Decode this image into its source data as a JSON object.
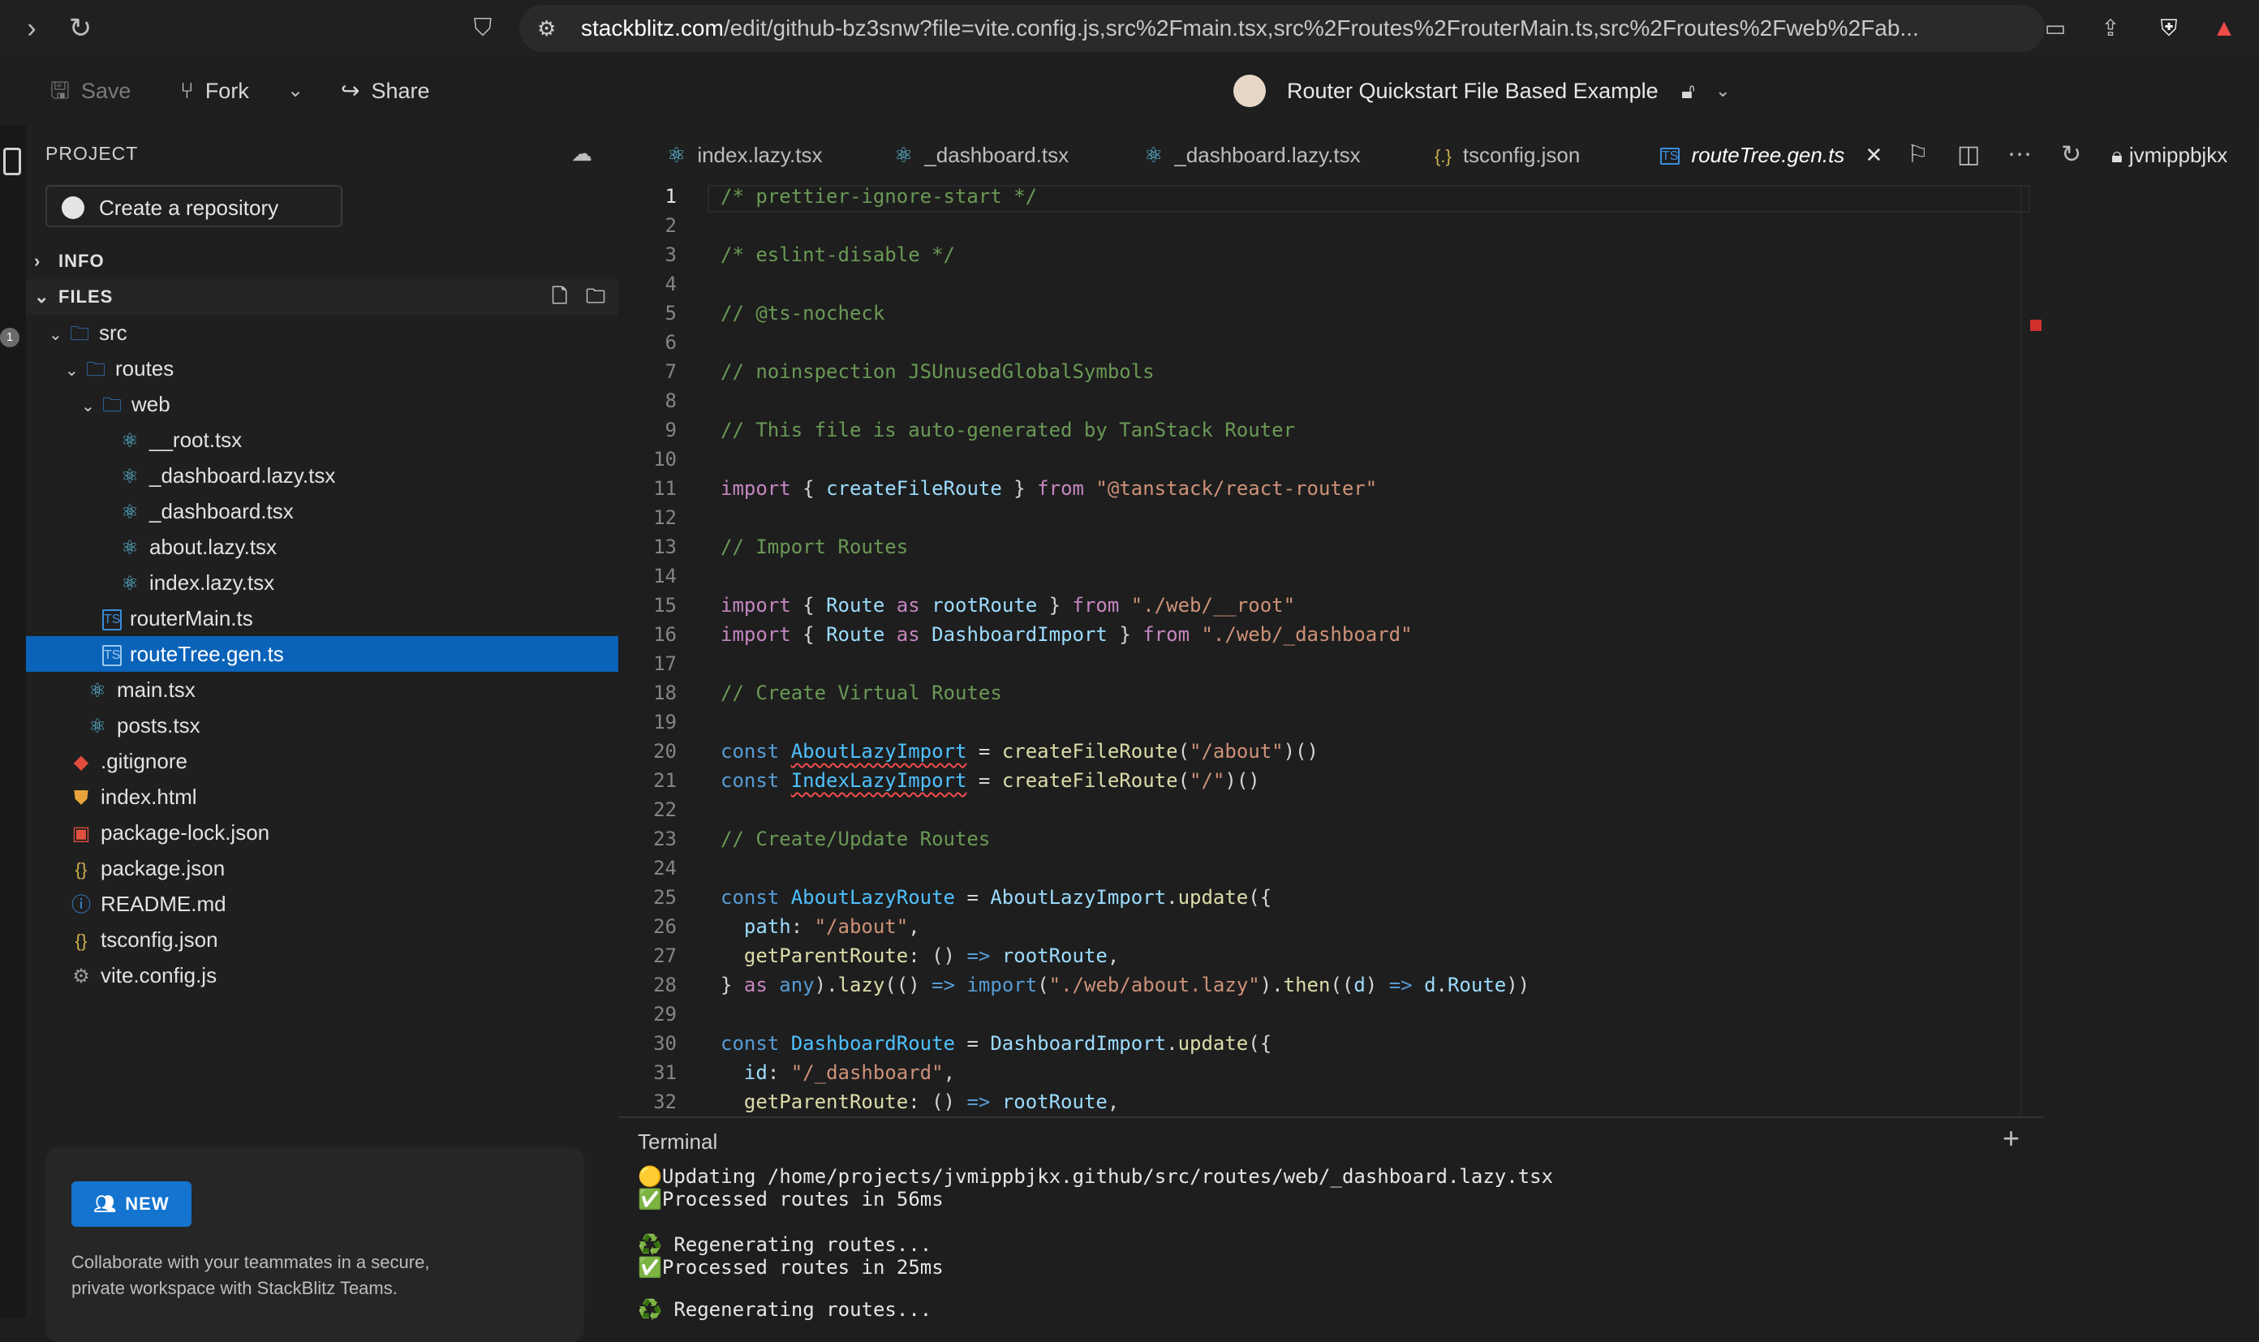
{
  "browser": {
    "url_host": "stackblitz.com",
    "url_path": "/edit/github-bz3snw?file=vite.config.js,src%2Fmain.tsx,src%2Froutes%2FrouterMain.ts,src%2Froutes%2Fweb%2Fab..."
  },
  "header": {
    "save_label": "Save",
    "fork_label": "Fork",
    "share_label": "Share",
    "project_title": "Router Quickstart File Based Example"
  },
  "sidebar": {
    "project_label": "PROJECT",
    "create_repo_label": "Create a repository",
    "info_label": "INFO",
    "files_label": "FILES",
    "tree": [
      {
        "label": "src",
        "icon": "folder"
      },
      {
        "label": "routes",
        "icon": "folder"
      },
      {
        "label": "web",
        "icon": "folder"
      },
      {
        "label": "__root.tsx",
        "icon": "react"
      },
      {
        "label": "_dashboard.lazy.tsx",
        "icon": "react"
      },
      {
        "label": "_dashboard.tsx",
        "icon": "react"
      },
      {
        "label": "about.lazy.tsx",
        "icon": "react"
      },
      {
        "label": "index.lazy.tsx",
        "icon": "react"
      },
      {
        "label": "routerMain.ts",
        "icon": "ts"
      },
      {
        "label": "routeTree.gen.ts",
        "icon": "ts"
      },
      {
        "label": "main.tsx",
        "icon": "react"
      },
      {
        "label": "posts.tsx",
        "icon": "react"
      },
      {
        "label": ".gitignore",
        "icon": "git"
      },
      {
        "label": "index.html",
        "icon": "html5"
      },
      {
        "label": "package-lock.json",
        "icon": "pkglock"
      },
      {
        "label": "package.json",
        "icon": "json"
      },
      {
        "label": "README.md",
        "icon": "info"
      },
      {
        "label": "tsconfig.json",
        "icon": "json"
      },
      {
        "label": "vite.config.js",
        "icon": "gear"
      }
    ],
    "promo": {
      "badge": "NEW",
      "text": "Collaborate with your teammates in a secure, private workspace with StackBlitz Teams."
    }
  },
  "tabs": [
    {
      "label": "index.lazy.tsx",
      "icon": "react"
    },
    {
      "label": "_dashboard.tsx",
      "icon": "react"
    },
    {
      "label": "_dashboard.lazy.tsx",
      "icon": "react"
    },
    {
      "label": "tsconfig.json",
      "icon": "json"
    },
    {
      "label": "routeTree.gen.ts",
      "icon": "ts",
      "active": true
    }
  ],
  "workspace_user": "jvmippbjkx",
  "editor": {
    "line_numbers": [
      "1",
      "2",
      "3",
      "4",
      "5",
      "6",
      "7",
      "8",
      "9",
      "10",
      "11",
      "12",
      "13",
      "14",
      "15",
      "16",
      "17",
      "18",
      "19",
      "20",
      "21",
      "22",
      "23",
      "24",
      "25",
      "26",
      "27",
      "28",
      "29",
      "30",
      "31",
      "32"
    ],
    "code": {
      "l1": "/* prettier-ignore-start */",
      "l3": "/* eslint-disable */",
      "l5": "// @ts-nocheck",
      "l7": "// noinspection JSUnusedGlobalSymbols",
      "l9": "// This file is auto-generated by TanStack Router",
      "l13": "// Import Routes",
      "l18": "// Create Virtual Routes",
      "l23": "// Create/Update Routes",
      "kw_import": "import",
      "kw_from": "from",
      "kw_as": "as",
      "kw_const": "const",
      "kw_any": "any",
      "createFileRoute": "createFileRoute",
      "Route": "Route",
      "rootRoute": "rootRoute",
      "DashboardImport": "DashboardImport",
      "AboutLazyImport": "AboutLazyImport",
      "IndexLazyImport": "IndexLazyImport",
      "AboutLazyRoute": "AboutLazyRoute",
      "DashboardRoute": "DashboardRoute",
      "s_router": "\"@tanstack/react-router\"",
      "s_root": "\"./web/__root\"",
      "s_dash": "\"./web/_dashboard\"",
      "s_about": "\"/about\"",
      "s_slash": "\"/\"",
      "s_about_lazy": "\"./web/about.lazy\"",
      "s_dash_id": "\"/_dashboard\"",
      "update": "update",
      "lazy": "lazy",
      "then": "then",
      "path": "path",
      "id": "id",
      "getParentRoute": "getParentRoute",
      "d": "d"
    }
  },
  "terminal": {
    "title": "Terminal",
    "lines": [
      "🟡Updating /home/projects/jvmippbjkx.github/src/routes/web/_dashboard.lazy.tsx",
      "✅Processed routes in 56ms",
      "",
      "♻️ Regenerating routes...",
      "✅Processed routes in 25ms",
      "",
      "♻️ Regenerating routes..."
    ]
  }
}
